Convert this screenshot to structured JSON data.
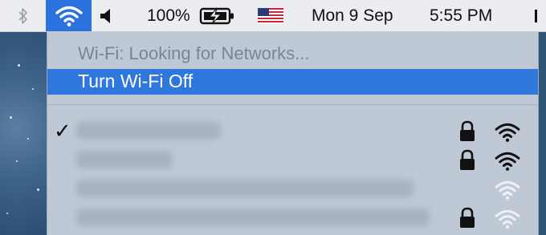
{
  "menubar": {
    "bluetooth_icon": "bluetooth-icon",
    "wifi_icon": "wifi-icon",
    "volume_icon": "speaker-icon",
    "battery_percent": "100%",
    "battery_icon": "battery-charging-icon",
    "input_source_icon": "us-flag-icon",
    "date": "Mon 9 Sep",
    "time": "5:55 PM",
    "extra_icon": "menu-extra-icon"
  },
  "wifi_menu": {
    "status": "Wi-Fi: Looking for Networks...",
    "toggle_action": "Turn Wi-Fi Off",
    "networks": [
      {
        "connected": true,
        "locked": true,
        "strength": "full"
      },
      {
        "connected": false,
        "locked": true,
        "strength": "full"
      },
      {
        "connected": false,
        "locked": false,
        "strength": "faint"
      },
      {
        "connected": false,
        "locked": true,
        "strength": "faint"
      }
    ]
  },
  "colors": {
    "menubar_bg": "#ecedf0",
    "highlight": "#2f77dc",
    "menu_bg": "#bfc9d6"
  }
}
